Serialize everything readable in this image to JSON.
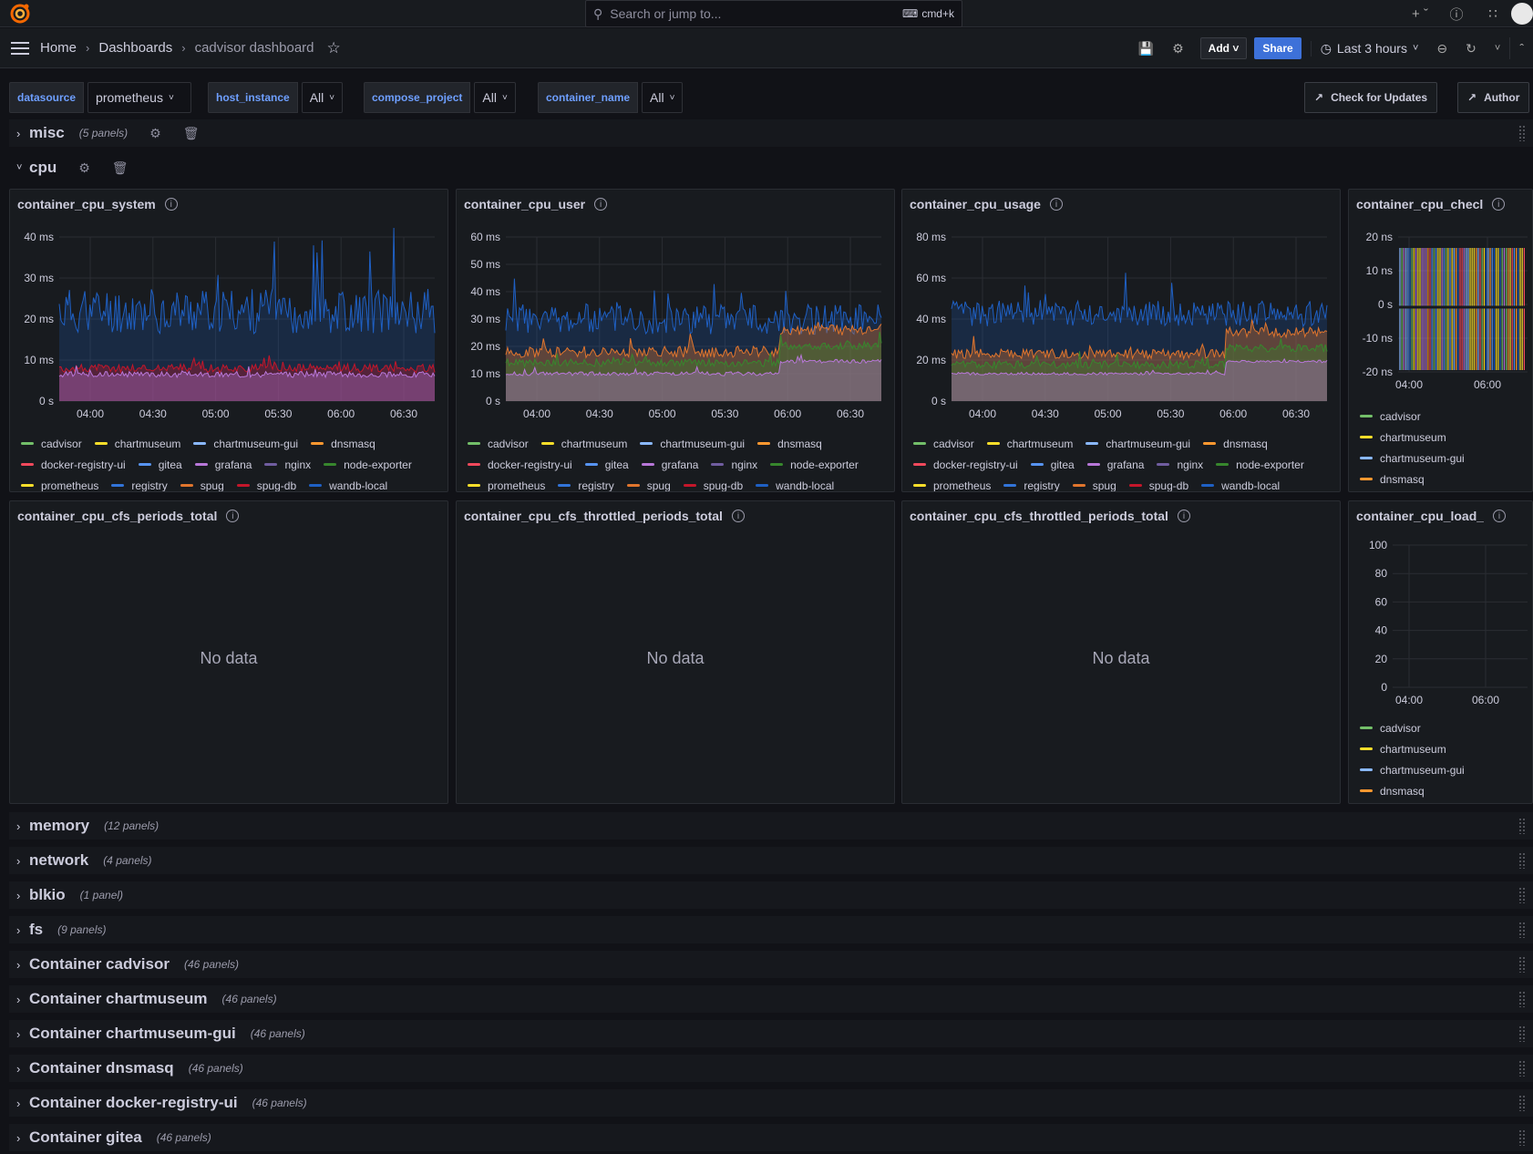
{
  "topbar": {
    "search_placeholder": "Search or jump to...",
    "search_shortcut": "cmd+k"
  },
  "nav": {
    "breadcrumbs": [
      "Home",
      "Dashboards",
      "cadvisor dashboard"
    ],
    "add_label": "Add",
    "share_label": "Share",
    "time_range": "Last 3 hours"
  },
  "variables": [
    {
      "label": "datasource",
      "value": "prometheus"
    },
    {
      "label": "host_instance",
      "value": "All"
    },
    {
      "label": "compose_project",
      "value": "All"
    },
    {
      "label": "container_name",
      "value": "All"
    }
  ],
  "links": {
    "updates": "Check for Updates",
    "author": "Author"
  },
  "rows": {
    "misc": {
      "title": "misc",
      "count": "(5 panels)"
    },
    "cpu": {
      "title": "cpu"
    },
    "collapsed": [
      {
        "title": "memory",
        "count": "(12 panels)"
      },
      {
        "title": "network",
        "count": "(4 panels)"
      },
      {
        "title": "blkio",
        "count": "(1 panel)"
      },
      {
        "title": "fs",
        "count": "(9 panels)"
      },
      {
        "title": "Container cadvisor",
        "count": "(46 panels)"
      },
      {
        "title": "Container chartmuseum",
        "count": "(46 panels)"
      },
      {
        "title": "Container chartmuseum-gui",
        "count": "(46 panels)"
      },
      {
        "title": "Container dnsmasq",
        "count": "(46 panels)"
      },
      {
        "title": "Container docker-registry-ui",
        "count": "(46 panels)"
      },
      {
        "title": "Container gitea",
        "count": "(46 panels)"
      }
    ]
  },
  "series_colors": {
    "cadvisor": "#73bf69",
    "chartmuseum": "#fade2a",
    "chartmuseum-gui": "#8ab8ff",
    "dnsmasq": "#ff9830",
    "docker-registry-ui": "#f2495c",
    "gitea": "#5794f2",
    "grafana": "#b877d9",
    "nginx": "#705da0",
    "node-exporter": "#37872d",
    "prometheus": "#fade2a",
    "registry": "#3274d9",
    "spug": "#e0752d",
    "spug-db": "#c4162a",
    "wandb-local": "#1f60c4"
  },
  "panels": {
    "p1": {
      "title": "container_cpu_system"
    },
    "p2": {
      "title": "container_cpu_user"
    },
    "p3": {
      "title": "container_cpu_usage"
    },
    "p4": {
      "title": "container_cpu_checl"
    },
    "p5": {
      "title": "container_cpu_cfs_periods_total",
      "nodata": "No data"
    },
    "p6": {
      "title": "container_cpu_cfs_throttled_periods_total",
      "nodata": "No data"
    },
    "p7": {
      "title": "container_cpu_cfs_throttled_periods_total",
      "nodata": "No data"
    },
    "p8": {
      "title": "container_cpu_load_"
    }
  },
  "legend_full": [
    [
      "cadvisor",
      "chartmuseum",
      "chartmuseum-gui",
      "dnsmasq"
    ],
    [
      "docker-registry-ui",
      "gitea",
      "grafana",
      "nginx",
      "node-exporter"
    ],
    [
      "prometheus",
      "registry",
      "spug",
      "spug-db",
      "wandb-local"
    ]
  ],
  "legend_short": [
    "cadvisor",
    "chartmuseum",
    "chartmuseum-gui",
    "dnsmasq"
  ],
  "chart_data": [
    {
      "type": "area",
      "title": "container_cpu_system",
      "x_ticks": [
        "04:00",
        "04:30",
        "05:00",
        "05:30",
        "06:00",
        "06:30"
      ],
      "y_ticks": [
        "0 s",
        "10 ms",
        "20 ms",
        "30 ms",
        "40 ms"
      ],
      "ylim": [
        0,
        40
      ],
      "series": [
        {
          "name": "wandb-local",
          "approx_level": 22,
          "noise": 8
        },
        {
          "name": "spug-db",
          "approx_level": 8,
          "noise": 1.5
        },
        {
          "name": "grafana",
          "approx_level": 6.5,
          "noise": 1
        }
      ]
    },
    {
      "type": "area",
      "title": "container_cpu_user",
      "x_ticks": [
        "04:00",
        "04:30",
        "05:00",
        "05:30",
        "06:00",
        "06:30"
      ],
      "y_ticks": [
        "0 s",
        "10 ms",
        "20 ms",
        "30 ms",
        "40 ms",
        "50 ms",
        "60 ms"
      ],
      "ylim": [
        0,
        60
      ],
      "series": [
        {
          "name": "wandb-local",
          "approx_level": 30,
          "noise": 8
        },
        {
          "name": "spug",
          "approx_level": 18,
          "noise": 3
        },
        {
          "name": "node-exporter",
          "approx_level": 14,
          "noise": 2
        },
        {
          "name": "grafana",
          "approx_level": 10,
          "noise": 1
        }
      ]
    },
    {
      "type": "area",
      "title": "container_cpu_usage",
      "x_ticks": [
        "04:00",
        "04:30",
        "05:00",
        "05:30",
        "06:00",
        "06:30"
      ],
      "y_ticks": [
        "0 s",
        "20 ms",
        "40 ms",
        "60 ms",
        "80 ms"
      ],
      "ylim": [
        0,
        90
      ],
      "series": [
        {
          "name": "wandb-local",
          "approx_level": 48,
          "noise": 10
        },
        {
          "name": "spug",
          "approx_level": 26,
          "noise": 4
        },
        {
          "name": "node-exporter",
          "approx_level": 20,
          "noise": 3
        },
        {
          "name": "grafana",
          "approx_level": 15,
          "noise": 1
        }
      ]
    },
    {
      "type": "line",
      "title": "container_cpu_checl",
      "x_ticks": [
        "04:00",
        "06:00"
      ],
      "y_ticks": [
        "-20 ns",
        "-10 ns",
        "0 s",
        "10 ns",
        "20 ns"
      ],
      "ylim": [
        -20,
        20
      ]
    },
    {
      "type": "line",
      "title": "container_cpu_load_",
      "x_ticks": [
        "04:00",
        "06:00"
      ],
      "y_ticks": [
        "0",
        "20",
        "40",
        "60",
        "80",
        "100"
      ],
      "ylim": [
        0,
        100
      ]
    }
  ]
}
